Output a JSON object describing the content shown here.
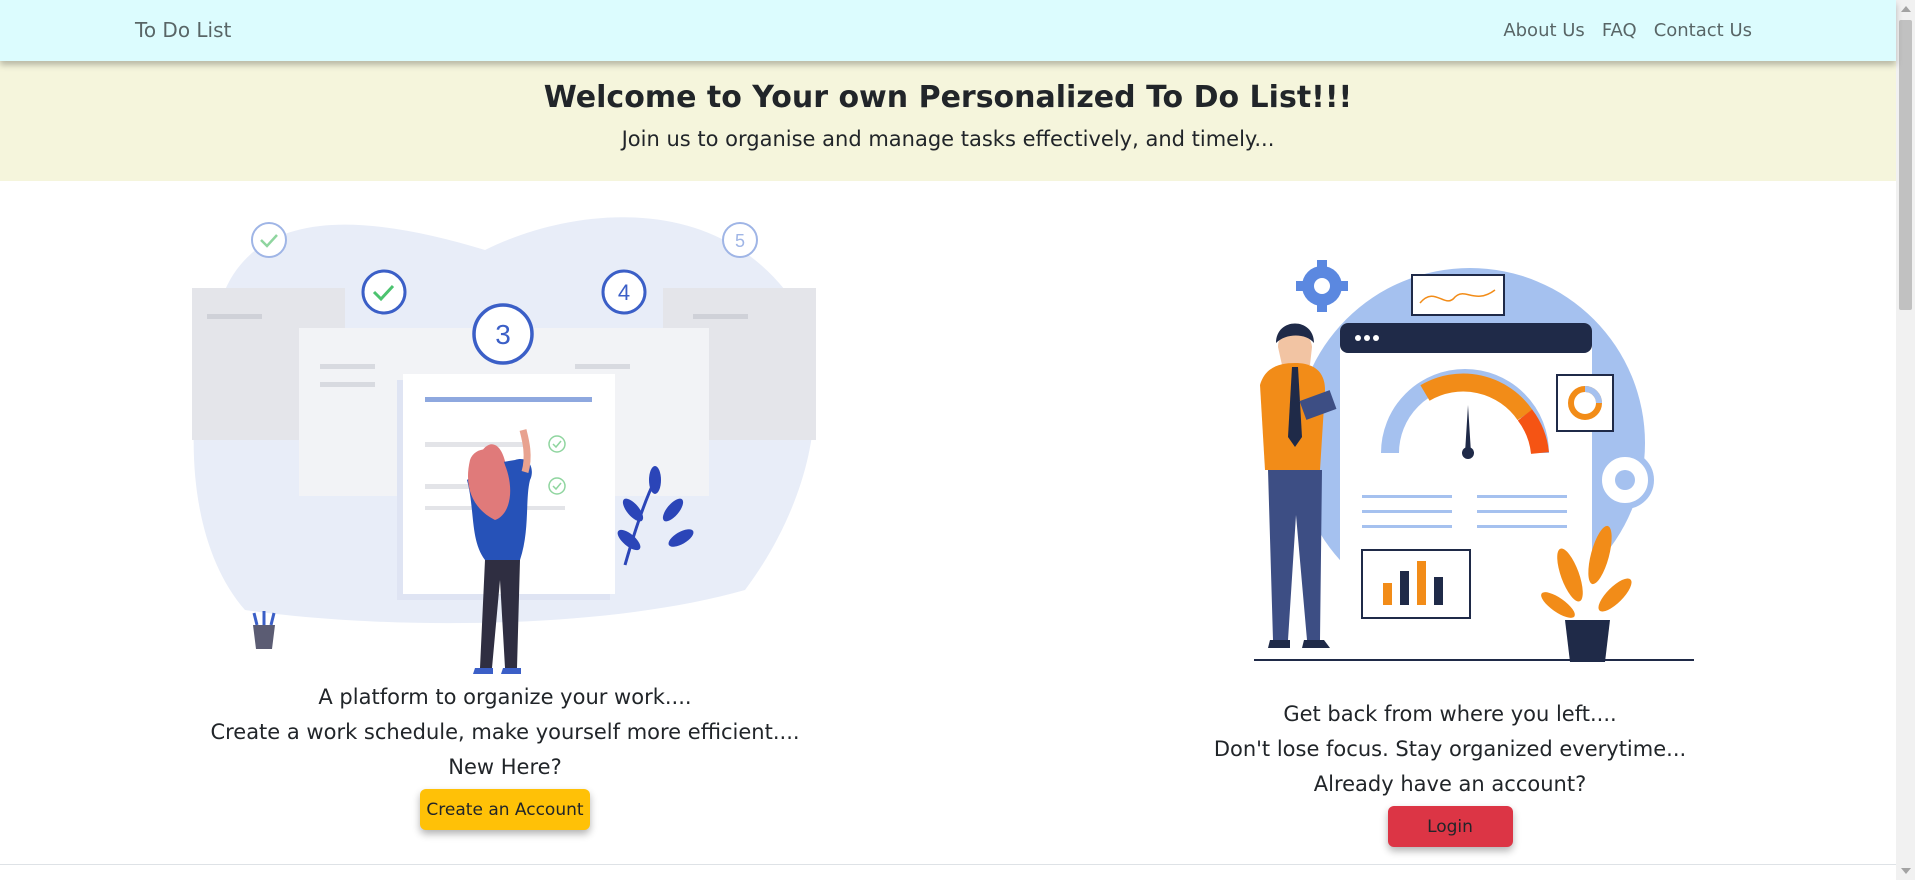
{
  "navbar": {
    "brand": "To Do List",
    "links": [
      "About Us",
      "FAQ",
      "Contact Us"
    ]
  },
  "hero": {
    "title": "Welcome to Your own Personalized To Do List!!!",
    "subtitle": "Join us to organise and manage tasks effectively, and timely..."
  },
  "left": {
    "line1": "A platform to organize your work....",
    "line2": "Create a work schedule, make yourself more efficient....",
    "line3": "New Here?",
    "button": "Create an Account"
  },
  "right": {
    "line1": "Get back from where you left....",
    "line2": "Don't lose focus. Stay organized everytime...",
    "line3": "Already have an account?",
    "button": "Login"
  },
  "illustration_numbers": [
    "3",
    "4",
    "5"
  ],
  "colors": {
    "navbar": "#dcfcfe",
    "hero": "#f5f5dc",
    "create_button": "#ffc107",
    "login_button": "#dc3545",
    "accent_blue": "#3b5fc7",
    "accent_orange": "#f28c18"
  }
}
